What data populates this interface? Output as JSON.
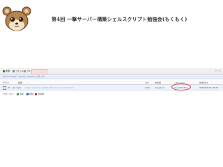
{
  "slide": {
    "title": "第4回 一撃サーバー構築シェルスクリプト勉強会(もくもく)"
  },
  "toolbar": {
    "buttons": [
      {
        "label": "新規",
        "icon": "plus-icon",
        "color": "#3a7d2b"
      },
      {
        "label": "コミット",
        "icon": "commit-icon",
        "color": "#888888"
      },
      {
        "label": "プル",
        "icon": "pull-icon",
        "color": "#999999"
      }
    ],
    "right_label": "ツール"
  },
  "path": {
    "text": "Mercurial.git: ~/prod/: project/ (ブランチ)"
  },
  "table": {
    "headers": {
      "graph": "グラフ",
      "title": "説明",
      "branch": "タグ",
      "author": "作成者",
      "revision": "リビジョン",
      "date": "作成日付"
    },
    "rows": [
      {
        "index": "21",
        "tag": "@ origin",
        "message": "· origin, project, update Mercurial en, Developer",
        "branch": "work",
        "author": "naoya.ho",
        "revision": "11(1ef7e7b)",
        "date": "2015/01/13 18:47"
      }
    ]
  },
  "footer": {
    "label": "クローズド:",
    "items": [
      {
        "label": "追加",
        "color": "#4a9a3a"
      },
      {
        "label": "削除",
        "color": "#2b5fb0"
      },
      {
        "label": "未追跡",
        "color": "#c23a3a"
      }
    ]
  },
  "colors": {
    "highlight_ring": "#e03030",
    "row_selected": "#eaf2ff",
    "mascot_fur": "#b5834e"
  }
}
